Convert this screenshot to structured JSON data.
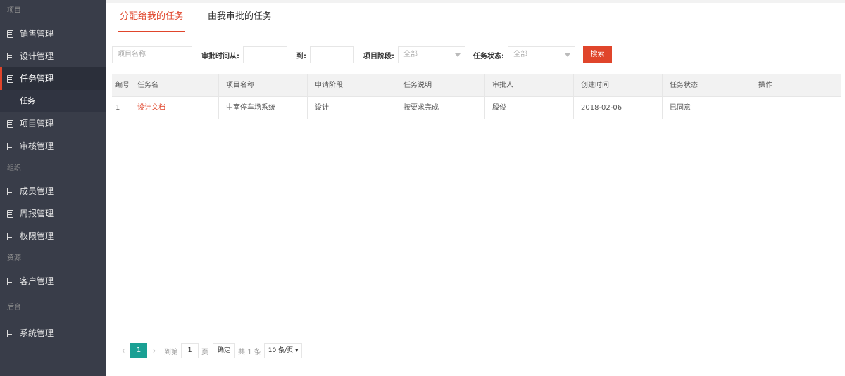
{
  "sidebar": {
    "groups": [
      {
        "label": "项目",
        "items": [
          {
            "label": "销售管理"
          },
          {
            "label": "设计管理"
          },
          {
            "label": "任务管理",
            "active": true,
            "sub": "任务"
          },
          {
            "label": "项目管理"
          },
          {
            "label": "审核管理"
          }
        ]
      },
      {
        "label": "组织",
        "items": [
          {
            "label": "成员管理"
          },
          {
            "label": "周报管理"
          },
          {
            "label": "权限管理"
          }
        ]
      },
      {
        "label": "资源",
        "items": [
          {
            "label": "客户管理"
          }
        ]
      },
      {
        "label": "后台",
        "items": [
          {
            "label": "系统管理"
          }
        ]
      }
    ]
  },
  "tabs": [
    {
      "label": "分配给我的任务",
      "active": true
    },
    {
      "label": "由我审批的任务",
      "active": false
    }
  ],
  "filters": {
    "project_name_placeholder": "项目名称",
    "time_from_label": "审批时间从:",
    "time_to_label": "到:",
    "stage_label": "项目阶段:",
    "stage_value": "全部",
    "status_label": "任务状态:",
    "status_value": "全部",
    "search_label": "搜索"
  },
  "table": {
    "columns": [
      "编号",
      "任务名",
      "项目名称",
      "申请阶段",
      "任务说明",
      "审批人",
      "创建时间",
      "任务状态",
      "操作"
    ],
    "rows": [
      [
        "1",
        "设计文档",
        "中南停车场系统",
        "设计",
        "按要求完成",
        "殷俊",
        "2018-02-06",
        "已同意",
        ""
      ]
    ]
  },
  "pager": {
    "prev": "‹",
    "current": "1",
    "next": "›",
    "goto_label": "到第",
    "goto_value": "1",
    "page_unit": "页",
    "confirm_label": "确定",
    "total_label": "共 1 条",
    "per_page": "10 条/页 ▾"
  },
  "colors": {
    "accent": "#e0452b",
    "pager_active": "#1aa094",
    "sidebar_bg": "#393d49"
  }
}
